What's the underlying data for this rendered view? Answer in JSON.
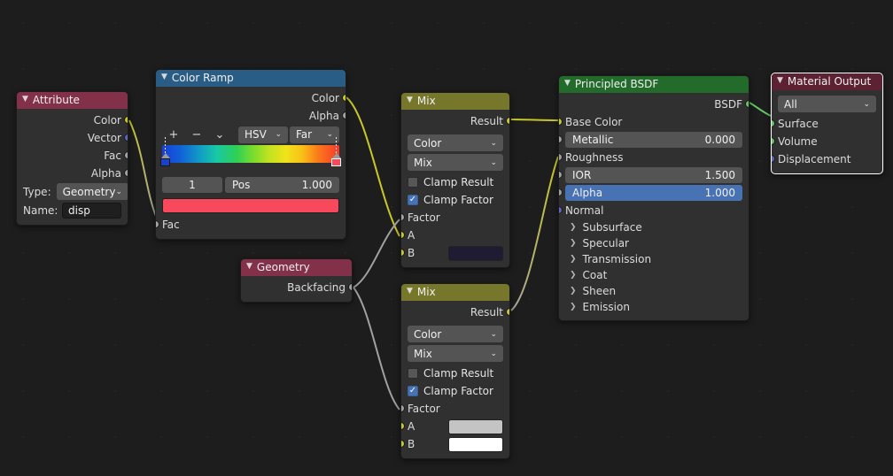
{
  "editor": {
    "name": "blender-shader-node-editor",
    "background": "#1d1d1d"
  },
  "nodes": {
    "attribute": {
      "title": "Attribute",
      "header_color": "#83314a",
      "outputs": [
        "Color",
        "Vector",
        "Fac",
        "Alpha"
      ],
      "type_label": "Type:",
      "type_value": "Geometry",
      "name_label": "Name:",
      "name_value": "disp"
    },
    "color_ramp": {
      "title": "Color Ramp",
      "header_color": "#2a5d86",
      "outputs": [
        "Color",
        "Alpha"
      ],
      "tools": [
        "+",
        "−",
        "⌄"
      ],
      "interpolation": "HSV",
      "hue_mode": "Far",
      "index_value": "1",
      "pos_label": "Pos",
      "pos_value": "1.000",
      "stop_color": "#f7485c",
      "input": "Fac"
    },
    "geometry": {
      "title": "Geometry",
      "header_color": "#83314a",
      "outputs": [
        "Backfacing"
      ]
    },
    "mix1": {
      "title": "Mix",
      "header_color": "#77772c",
      "output": "Result",
      "data_type": "Color",
      "blend_mode": "Mix",
      "clamp_result_label": "Clamp Result",
      "clamp_result_checked": false,
      "clamp_factor_label": "Clamp Factor",
      "clamp_factor_checked": true,
      "inputs": [
        "Factor",
        "A",
        "B"
      ],
      "b_color": "#1e1b33"
    },
    "mix2": {
      "title": "Mix",
      "header_color": "#77772c",
      "output": "Result",
      "data_type": "Color",
      "blend_mode": "Mix",
      "clamp_result_label": "Clamp Result",
      "clamp_result_checked": false,
      "clamp_factor_label": "Clamp Factor",
      "clamp_factor_checked": true,
      "inputs": [
        "Factor",
        "A",
        "B"
      ],
      "a_color": "#c4c4c4",
      "b_color": "#ffffff"
    },
    "principled_bsdf": {
      "title": "Principled BSDF",
      "header_color": "#236b2b",
      "output": "BSDF",
      "base_color_label": "Base Color",
      "metallic_label": "Metallic",
      "metallic_value": "0.000",
      "roughness_label": "Roughness",
      "ior_label": "IOR",
      "ior_value": "1.500",
      "alpha_label": "Alpha",
      "alpha_value": "1.000",
      "alpha_highlight": "#4772b3",
      "normal_label": "Normal",
      "sections": [
        "Subsurface",
        "Specular",
        "Transmission",
        "Coat",
        "Sheen",
        "Emission"
      ]
    },
    "material_output": {
      "title": "Material Output",
      "header_color": "#5c2233",
      "target": "All",
      "inputs": [
        "Surface",
        "Volume",
        "Displacement"
      ],
      "selected": true
    }
  }
}
